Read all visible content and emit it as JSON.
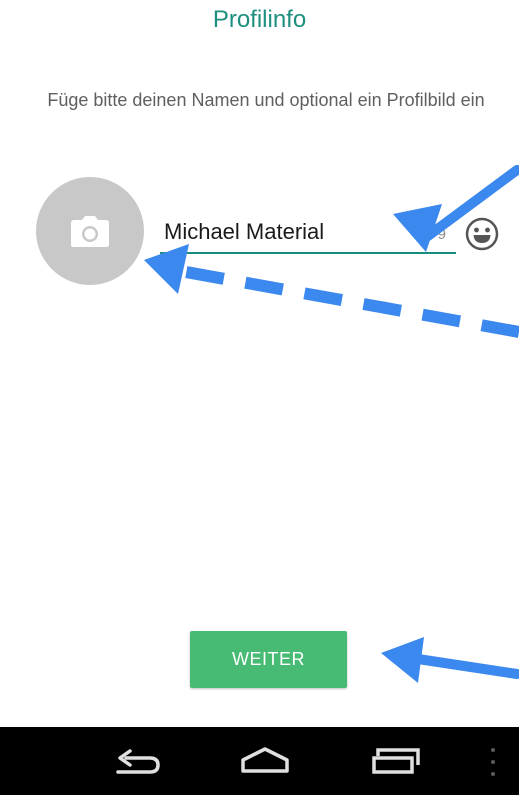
{
  "header": {
    "title": "Profilinfo"
  },
  "intro": {
    "text": "Füge bitte deinen Namen und optional ein Profilbild ein"
  },
  "profile": {
    "name_value": "Michael Material",
    "char_count": "9",
    "photo_icon": "camera-icon",
    "emoji_icon": "smiley-icon"
  },
  "actions": {
    "next_label": "WEITER"
  },
  "navbar": {
    "back_icon": "back-icon",
    "home_icon": "home-icon",
    "recents_icon": "recents-icon"
  },
  "colors": {
    "title": "#1e8f7e",
    "underline": "#168d80",
    "button": "#47ba74",
    "avatar": "#c8c8c8",
    "annotation_arrows": "#3b88ee",
    "navbar": "#000000"
  }
}
